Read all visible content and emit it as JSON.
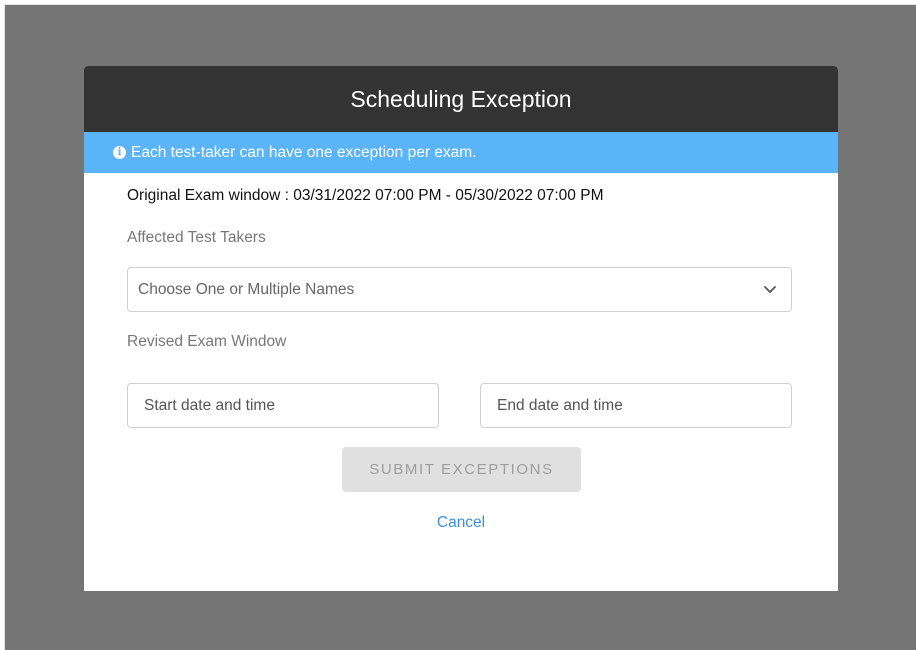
{
  "modal": {
    "title": "Scheduling Exception",
    "info_text": "Each test-taker can have one exception per exam.",
    "info_icon": "info-circle-icon",
    "original_window": "Original Exam window : 03/31/2022 07:00 PM - 05/30/2022 07:00 PM",
    "affected_label": "Affected Test Takers",
    "names_select": {
      "placeholder": "Choose One or Multiple Names",
      "icon": "chevron-down-icon"
    },
    "revised_label": "Revised Exam Window",
    "start_input": {
      "placeholder": "Start date and time",
      "value": ""
    },
    "end_input": {
      "placeholder": "End date and time",
      "value": ""
    },
    "submit_label": "SUBMIT EXCEPTIONS",
    "cancel_label": "Cancel"
  },
  "colors": {
    "header_bg": "#333333",
    "banner_bg": "#5ab4f7",
    "backdrop": "#757575",
    "link": "#3a8fd8",
    "button_disabled_bg": "#e0e0e0"
  }
}
